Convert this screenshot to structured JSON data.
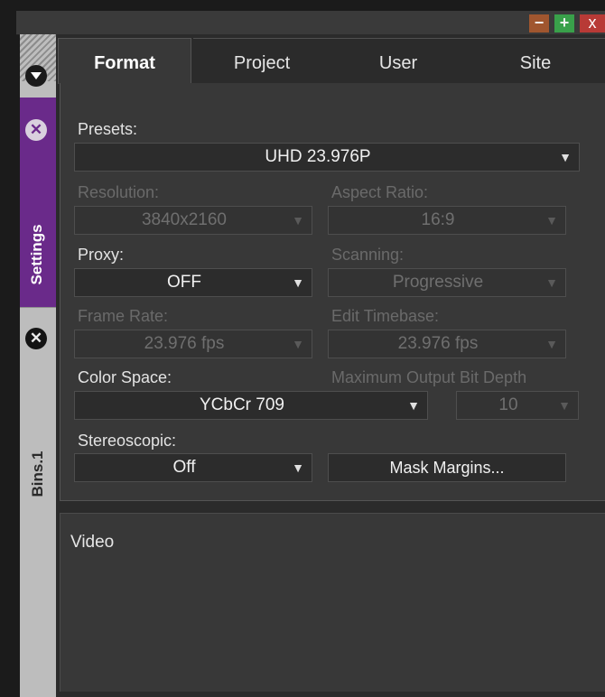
{
  "window": {
    "buttons": {
      "minimize": "−",
      "maximize": "+",
      "close": "x"
    }
  },
  "sidebar": {
    "tabs": [
      {
        "label": "Settings",
        "active": true
      },
      {
        "label": "Bins.1",
        "active": false
      }
    ]
  },
  "tabs": [
    {
      "label": "Format",
      "active": true
    },
    {
      "label": "Project",
      "active": false
    },
    {
      "label": "User",
      "active": false
    },
    {
      "label": "Site",
      "active": false
    }
  ],
  "format": {
    "presets": {
      "label": "Presets:",
      "value": "UHD 23.976P"
    },
    "resolution": {
      "label": "Resolution:",
      "value": "3840x2160",
      "enabled": false
    },
    "aspect_ratio": {
      "label": "Aspect Ratio:",
      "value": "16:9",
      "enabled": false
    },
    "proxy": {
      "label": "Proxy:",
      "value": "OFF"
    },
    "scanning": {
      "label": "Scanning:",
      "value": "Progressive",
      "enabled": false
    },
    "frame_rate": {
      "label": "Frame Rate:",
      "value": "23.976 fps",
      "enabled": false
    },
    "edit_timebase": {
      "label": "Edit Timebase:",
      "value": "23.976 fps",
      "enabled": false
    },
    "color_space": {
      "label": "Color Space:",
      "value": "YCbCr 709"
    },
    "max_bit_depth": {
      "label": "Maximum Output Bit Depth",
      "value": "10",
      "enabled": false
    },
    "stereoscopic": {
      "label": "Stereoscopic:",
      "value": "Off"
    },
    "mask_margins": {
      "label": "Mask Margins..."
    }
  },
  "video_section": {
    "label": "Video"
  },
  "colors": {
    "accent_purple": "#6a2a8a",
    "panel_bg": "#383838"
  },
  "icons": {
    "dropdown_arrow": "▼",
    "close_circle": "✕"
  }
}
